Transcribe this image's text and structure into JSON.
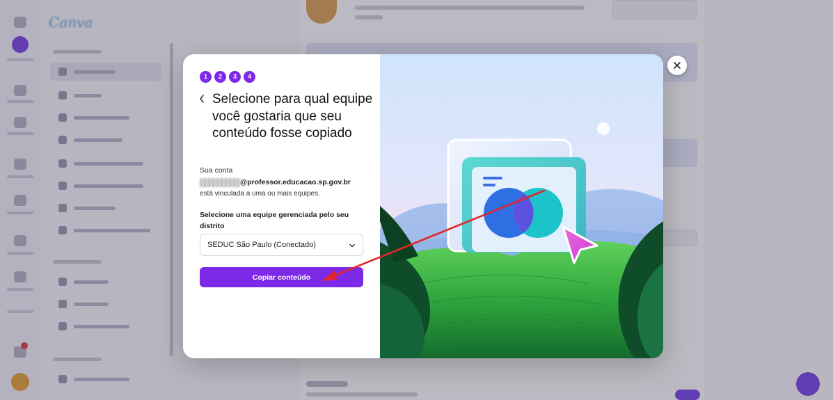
{
  "dialog": {
    "steps": [
      "1",
      "2",
      "3",
      "4"
    ],
    "title": "Selecione para qual equipe você gostaria que seu conteúdo fosse copiado",
    "account_label": "Sua conta",
    "email_domain": "@professor.educacao.sp.gov.br",
    "linked_text": "está vinculada a uma ou mais equipes.",
    "select_label": "Selecione uma equipe gerenciada pelo seu distrito",
    "selected_team": "SEDUC São Paulo (Conectado)",
    "copy_button": "Copiar conteúdo"
  },
  "colors": {
    "accent": "#7d2ae8",
    "annotation_arrow": "#e0262b"
  },
  "icons": {
    "back": "chevron-left-icon",
    "dropdown": "chevron-down-icon",
    "close": "close-icon",
    "cursor": "pointer-arrow-icon"
  }
}
